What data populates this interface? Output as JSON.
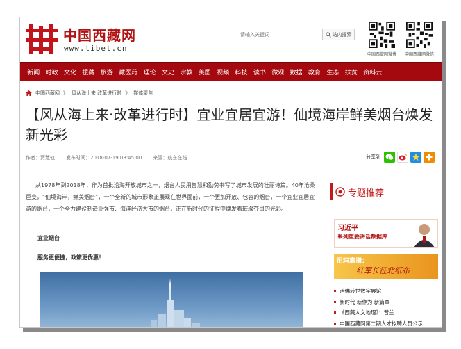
{
  "header": {
    "logo_cn": "中国西藏网",
    "logo_url": "www.tibet.cn",
    "search_placeholder": "请输入关键词",
    "search_button": "站内搜索",
    "qr_labels": [
      "中国西藏网微博",
      "中国西藏网微信"
    ]
  },
  "nav": {
    "items": [
      "新闻",
      "时政",
      "文化",
      "援藏",
      "旅游",
      "藏医药",
      "理论",
      "文史",
      "宗教",
      "美图",
      "视频",
      "科技",
      "读书",
      "微观",
      "数据",
      "教育",
      "生态",
      "扶贫",
      "资料云"
    ]
  },
  "breadcrumb": {
    "items": [
      "中国西藏网",
      "风从海上来 改革进行时",
      "媒体聚焦"
    ],
    "separator": "》"
  },
  "article": {
    "title": "【风从海上来·改革进行时】宜业宜居宜游！仙境海岸鲜美烟台焕发新光彩",
    "author": "作者：贾慧轨",
    "time": "发布时间：2018-07-19 08:45:00",
    "source": "来源：航东在线",
    "share_label": "分享到",
    "paragraph": "从1978年到2018年，作为首批沿海开放城市之一，烟台人民用智慧和勤劳书写了城市发展的壮丽诗篇。40年沧桑巨变，“仙境海岸，鲜美烟台”，一个全新的城市形象正展现在世界面前，一个更加开放、包容的烟台，一个宜业宜居宜游的烟台，一个全力建设制造业强市、海洋经济大市的烟台，正在新时代的征程中焕发着璀璨夺目的光彩。",
    "sub1": "宜业烟台",
    "sub2": "服务更便捷，政策更优惠！"
  },
  "sidebar": {
    "title": "专题推荐",
    "banner1_title": "习近平",
    "banner1_sub": "系列重要讲话数据库",
    "banner2_title": "尼玛嘉措：",
    "banner2_sub": "红军长征北纸布",
    "items": [
      "活佛转世数字展馆",
      "新时代 新作为 新篇章",
      "《西藏人文地理》：普兰",
      "中国西藏网第二期人才拟聘人员公示"
    ]
  },
  "colors": {
    "brand_red": "#a3090e",
    "accent_red": "#c31a1a"
  }
}
